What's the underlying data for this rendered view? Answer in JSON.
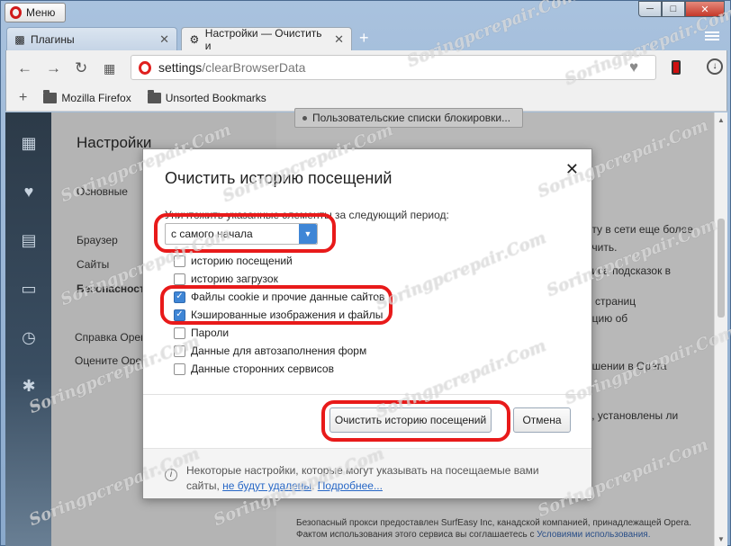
{
  "browser": {
    "menu_label": "Меню",
    "tabs": [
      {
        "label": "Плагины",
        "icon": "puzzle-icon"
      },
      {
        "label": "Настройки — Очистить и",
        "icon": "gear-icon"
      }
    ],
    "address": {
      "host": "settings",
      "path": "/clearBrowserData"
    },
    "bookmarks": [
      "Mozilla Firefox",
      "Unsorted Bookmarks"
    ]
  },
  "settings": {
    "title": "Настройки",
    "nav": [
      "Основные",
      "Браузер",
      "Сайты",
      "Безопасность"
    ],
    "links": [
      "Справка Opera",
      "Оцените Opera"
    ],
    "bg_button": "Пользовательские списки блокировки...",
    "bg_lines": [
      "оту в сети еще более",
      "очить.",
      "виса подсказок в",
      "и страниц",
      "ацию об",
      "ешении в Opera",
      "ь, установлены ли"
    ],
    "footnote": [
      "Безопасный прокси предоставлен SurfEasy Inc, канадской компанией, принадлежащей Opera.",
      "Фактом использования этого сервиса вы соглашаетесь с ",
      "Условиями использования."
    ]
  },
  "dialog": {
    "title": "Очистить историю посещений",
    "period_label": "Уничтожить указанные элементы за следующий период:",
    "period_value": "с самого начала",
    "options": [
      {
        "label": "историю посещений",
        "checked": false
      },
      {
        "label": "историю загрузок",
        "checked": false
      },
      {
        "label": "Файлы cookie и прочие данные сайтов",
        "checked": true
      },
      {
        "label": "Кэшированные изображения и файлы",
        "checked": true
      },
      {
        "label": "Пароли",
        "checked": false
      },
      {
        "label": "Данные для автозаполнения форм",
        "checked": false
      },
      {
        "label": "Данные сторонних сервисов",
        "checked": false
      }
    ],
    "clear_button": "Очистить историю посещений",
    "cancel_button": "Отмена",
    "footer_text": "Некоторые настройки, которые могут указывать на посещаемые вами сайты, ",
    "footer_link1": "не будут удалены",
    "footer_link2": "Подробнее...",
    "highlight_color": "#e81a1a",
    "accent_color": "#3f86d6"
  },
  "watermark": "Soringpcrepair.Com"
}
